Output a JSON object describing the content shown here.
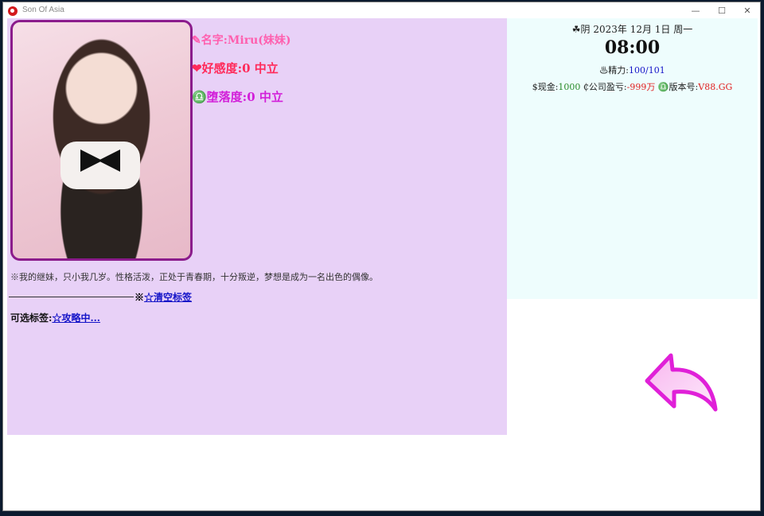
{
  "window": {
    "title": "Son Of Asia",
    "min_glyph": "—",
    "max_glyph": "☐",
    "close_glyph": "✕"
  },
  "character": {
    "name": "✎名字:Miru(妹妹)",
    "affection": "❤好感度:0  中立",
    "corruption": "♎堕落度:0  中立",
    "description": "※我的继妹，只小我几岁。性格活泼，正处于青春期，十分叛逆，梦想是成为一名出色的偶像。",
    "clear_tags_prefix": "※",
    "clear_tags_label": "☆清空标签",
    "tags_prefix": "可选标签:",
    "tags_link": "☆攻略中..."
  },
  "status": {
    "date": "☘阴 2023年 12月 1日 周一",
    "time": "08:00",
    "energy_label": "♨精力:",
    "energy_value": "100/101",
    "cash_label": "$现金:",
    "cash_value": "1000",
    "debt_label": "₵公司盈亏:",
    "debt_value": "-999万",
    "version_label": "♎版本号:",
    "version_value": "V88.GG"
  },
  "icons": {
    "app": "app-logo-icon",
    "back": "back-arrow-icon"
  },
  "colors": {
    "left_panel_bg": "#e8d1f7",
    "right_panel_bg": "#eefdfd",
    "name": "#ff5fae",
    "affection": "#ff2a5a",
    "corruption": "#d21fd9",
    "link": "#1414c8",
    "back_arrow": "#e020d8"
  }
}
